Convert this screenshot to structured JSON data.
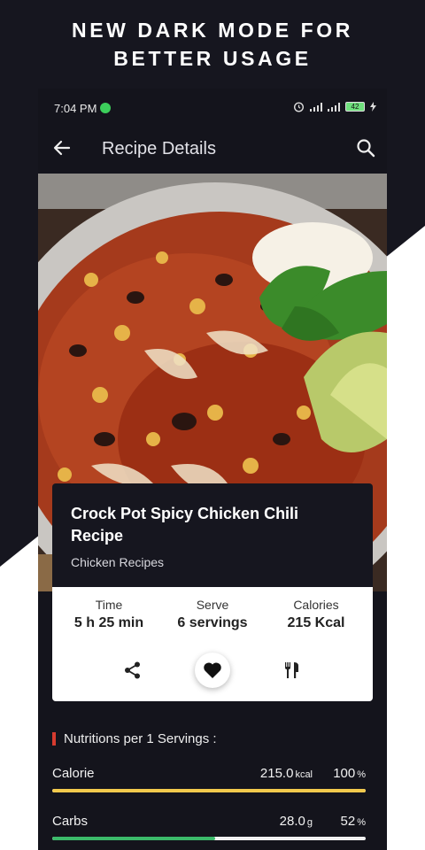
{
  "banner": {
    "line1": "NEW DARK MODE FOR",
    "line2": "BETTER USAGE"
  },
  "status_bar": {
    "time": "7:04 PM",
    "battery": "42"
  },
  "app_bar": {
    "title": "Recipe Details",
    "back_icon": "arrow-left-icon",
    "search_icon": "search-icon"
  },
  "hero_image": {
    "subject": "chili"
  },
  "recipe": {
    "title": "Crock Pot Spicy Chicken Chili Recipe",
    "category": "Chicken Recipes",
    "stats": [
      {
        "label": "Time",
        "value": "5 h 25 min"
      },
      {
        "label": "Serve",
        "value": "6 servings"
      },
      {
        "label": "Calories",
        "value": "215 Kcal"
      }
    ],
    "actions": [
      "share-icon",
      "heart-icon",
      "utensils-icon"
    ]
  },
  "nutrition": {
    "heading": "Nutritions per 1 Servings :",
    "items": [
      {
        "name": "Calorie",
        "amount": "215.0",
        "unit": "kcal",
        "percent": "100",
        "percent_unit": "%",
        "fraction": 1.0,
        "color": "#f2c94c"
      },
      {
        "name": "Carbs",
        "amount": "28.0",
        "unit": "g",
        "percent": "52",
        "percent_unit": "%",
        "fraction": 0.52,
        "color": "#3cba6a"
      }
    ]
  },
  "colors": {
    "background": "#16161f",
    "accent_red": "#d63b2f",
    "card_dark": "#16161f",
    "card_light": "#ffffff"
  }
}
